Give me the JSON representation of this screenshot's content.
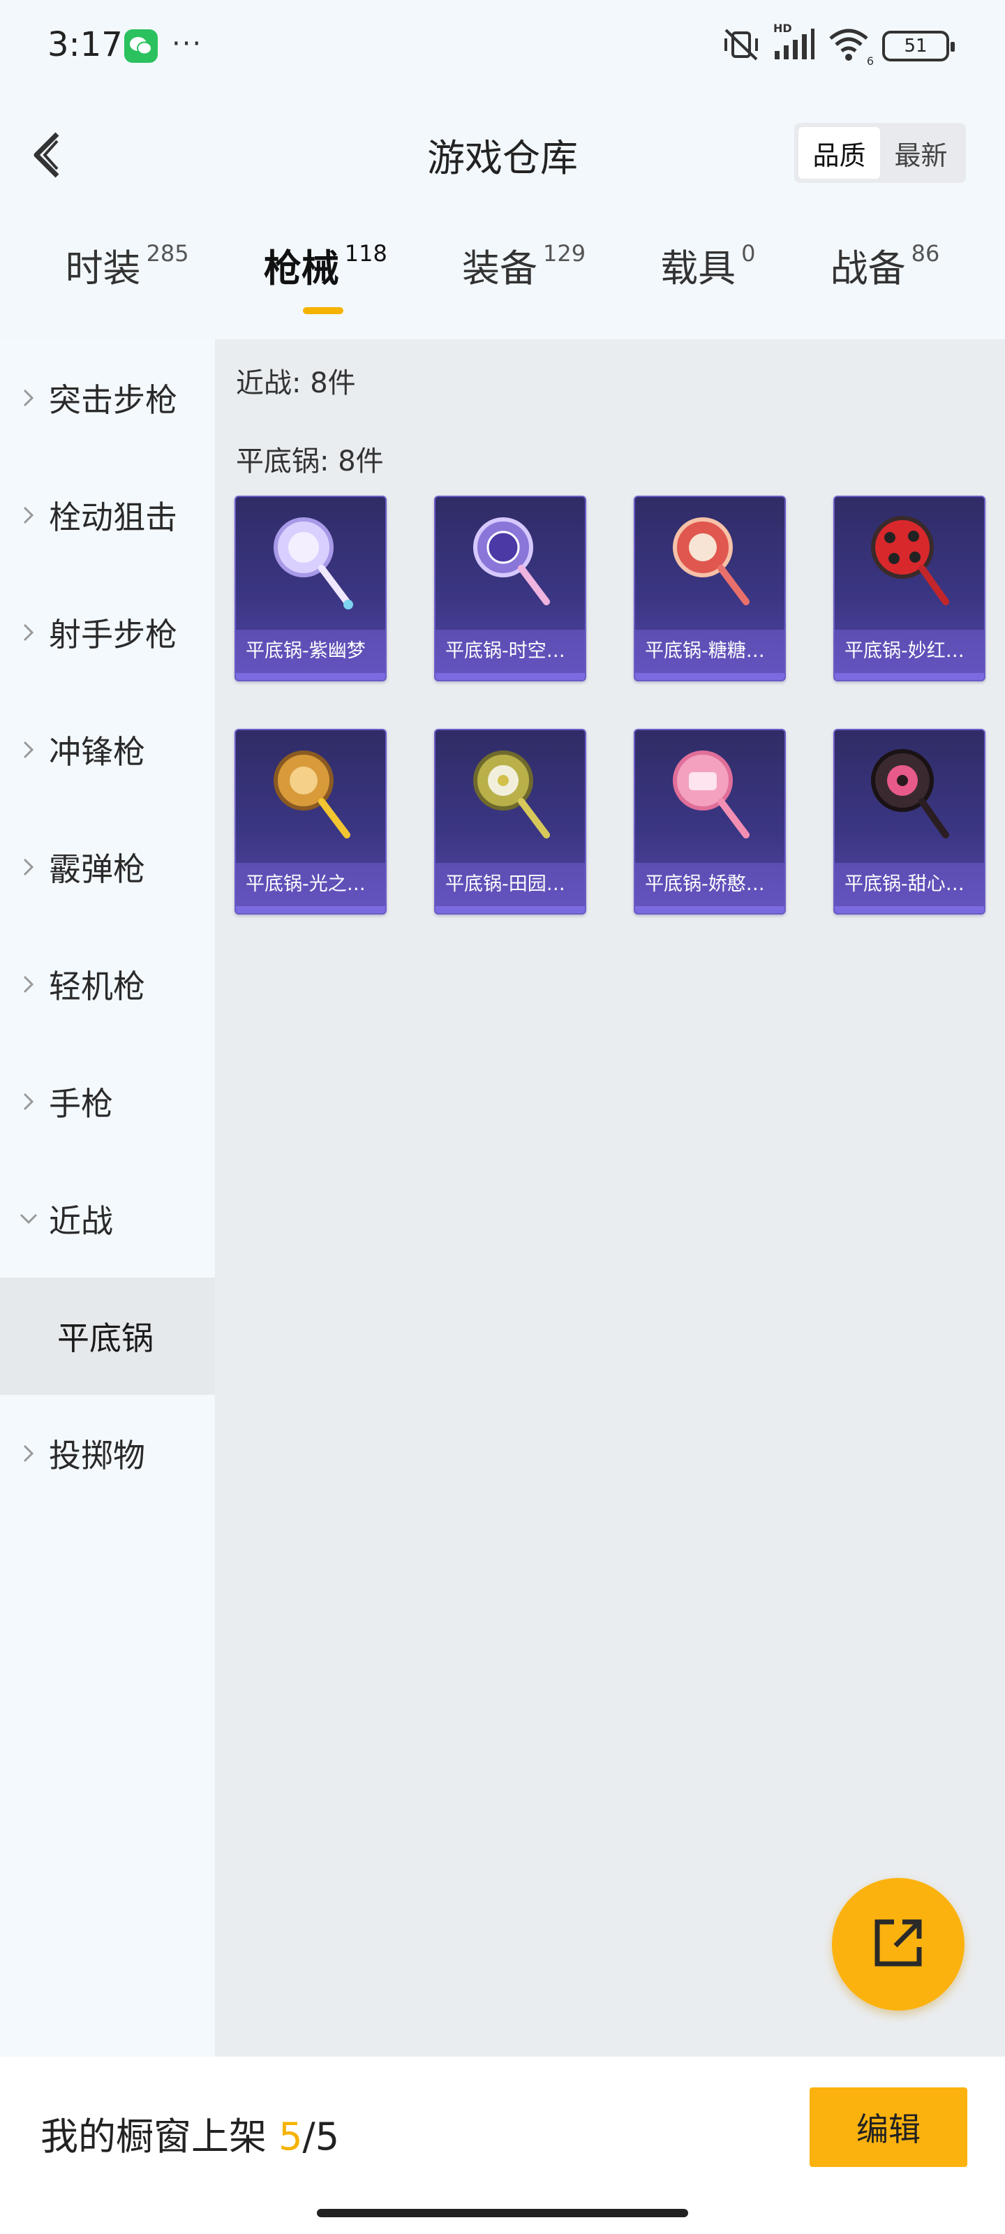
{
  "status_bar": {
    "time": "3:17",
    "dots": "···",
    "hd_label": "HD",
    "wifi_sub": "6",
    "battery": "51"
  },
  "header": {
    "title": "游戏仓库",
    "sort_options": [
      "品质",
      "最新"
    ],
    "active_sort": "品质"
  },
  "tabs": [
    {
      "label": "时装",
      "count": "285"
    },
    {
      "label": "枪械",
      "count": "118",
      "active": true
    },
    {
      "label": "装备",
      "count": "129"
    },
    {
      "label": "载具",
      "count": "0"
    },
    {
      "label": "战备",
      "count": "86"
    }
  ],
  "sidebar": {
    "items": [
      {
        "label": "突击步枪"
      },
      {
        "label": "栓动狙击"
      },
      {
        "label": "射手步枪"
      },
      {
        "label": "冲锋枪"
      },
      {
        "label": "霰弹枪"
      },
      {
        "label": "轻机枪"
      },
      {
        "label": "手枪"
      },
      {
        "label": "近战",
        "expanded": true
      },
      {
        "label": "投掷物"
      }
    ],
    "sub_items": [
      {
        "label": "平底锅",
        "selected": true
      }
    ]
  },
  "main": {
    "category_label": "近战: 8件",
    "subcategory_label": "平底锅: 8件",
    "items": [
      {
        "name": "平底锅-紫幽梦",
        "icon": "purple-dream-pan",
        "color": "#d9d0ff"
      },
      {
        "name": "平底锅-时空…",
        "icon": "spacetime-pan",
        "color": "#8a76d8"
      },
      {
        "name": "平底锅-糖糖…",
        "icon": "candy-pan",
        "color": "#e0574f"
      },
      {
        "name": "平底锅-妙红…",
        "icon": "ladybug-pan",
        "color": "#d8282c"
      },
      {
        "name": "平底锅-光之…",
        "icon": "light-pan",
        "color": "#d99a3a"
      },
      {
        "name": "平底锅-田园…",
        "icon": "pastoral-pan",
        "color": "#b9b04a"
      },
      {
        "name": "平底锅-娇憨…",
        "icon": "cute-pan",
        "color": "#f3a1bf"
      },
      {
        "name": "平底锅-甜心…",
        "icon": "sweetheart-pan",
        "color": "#3a2a30"
      }
    ]
  },
  "bottom": {
    "shelf_prefix": "我的橱窗上架 ",
    "shelf_current": "5",
    "shelf_total": "/5",
    "edit_label": "编辑"
  },
  "colors": {
    "accent": "#fcb20e",
    "card_bg": "#3b3683"
  }
}
